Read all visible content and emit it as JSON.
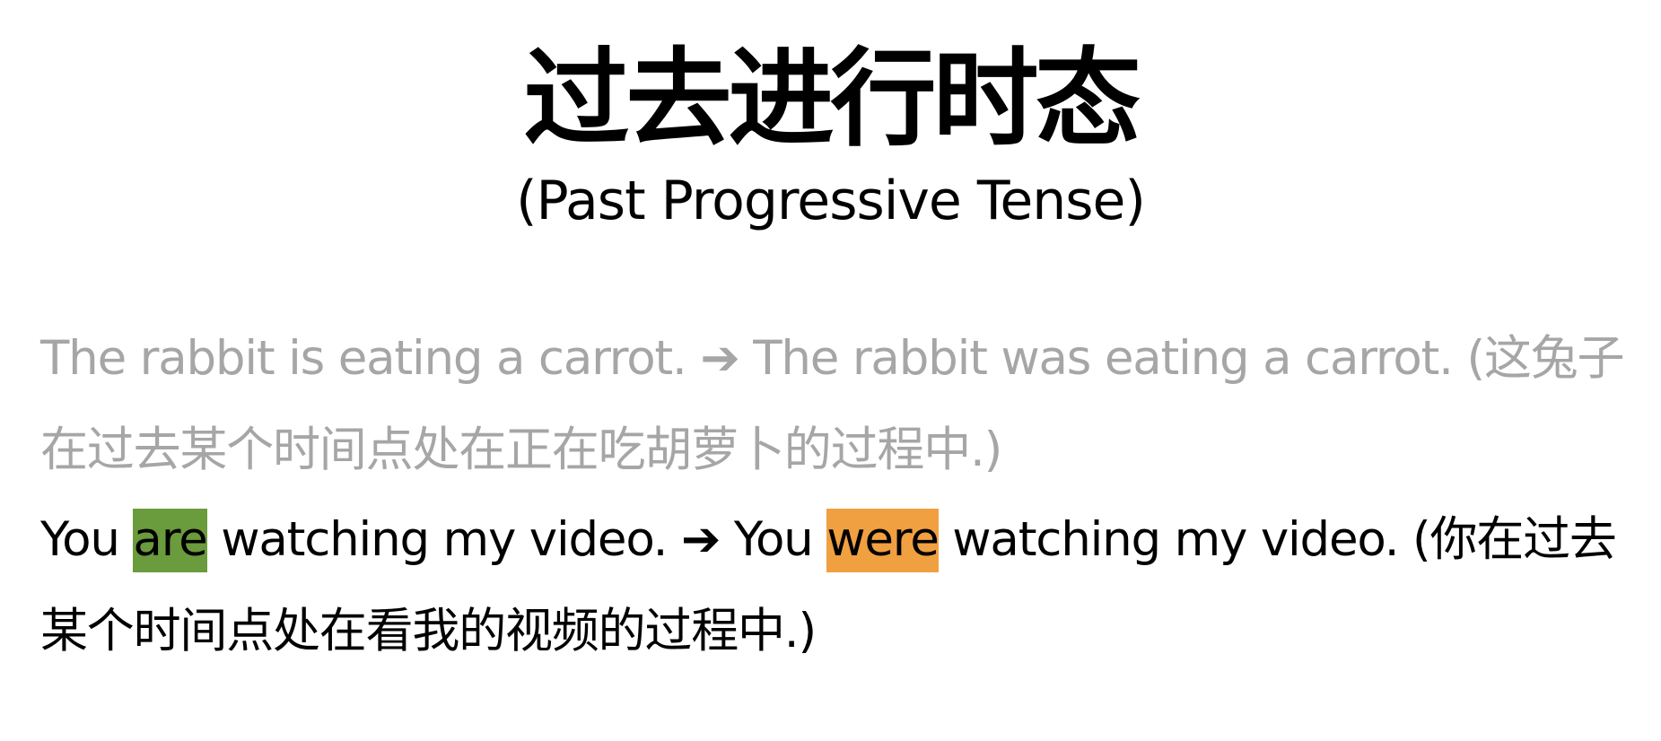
{
  "title": "过去进行时态",
  "subtitle": "(Past Progressive Tense)",
  "colors": {
    "faded_text": "#a6a6a6",
    "body_text": "#000000",
    "highlight_green": "#6a9b3c",
    "highlight_orange": "#f0a040"
  },
  "examples": [
    {
      "present": "The rabbit is eating a carrot.",
      "arrow": "➔",
      "past": "The rabbit was eating a carrot.",
      "translation": "(这兔子在过去某个时间点处在正在吃胡萝卜的过程中.)"
    },
    {
      "present_before": "You",
      "present_highlight": "are",
      "present_after": "watching my video.",
      "arrow": "➔",
      "past_before": "You",
      "past_highlight": "were",
      "past_after": "watching my video.",
      "translation": "(你在过去某个时间点处在看我的视频的过程中.)"
    }
  ]
}
